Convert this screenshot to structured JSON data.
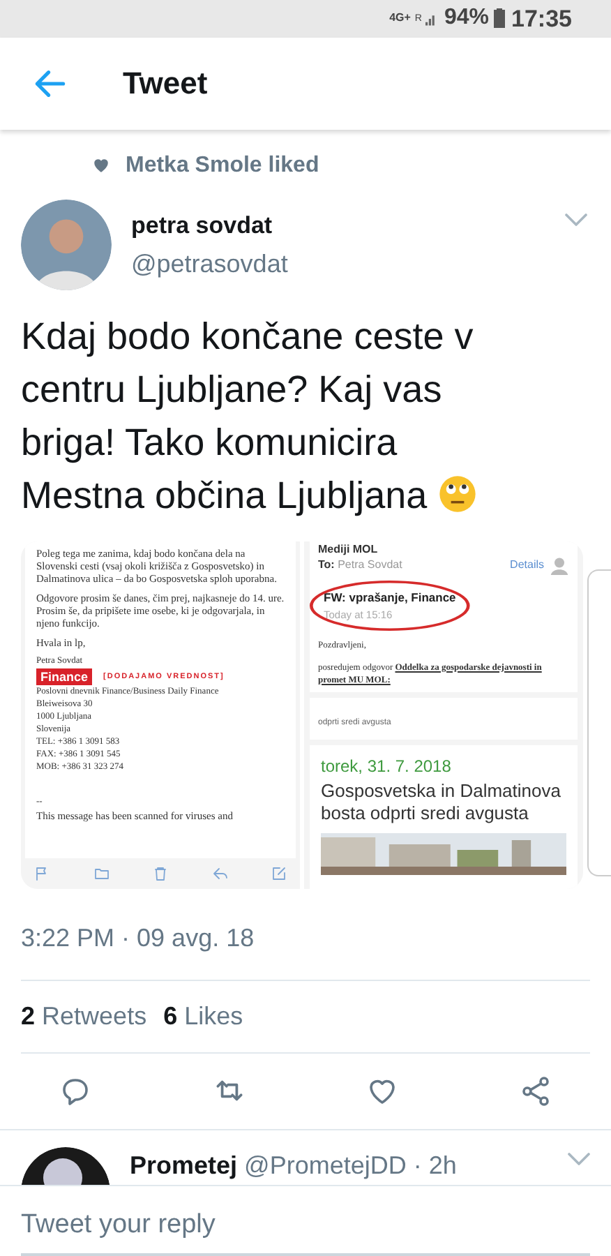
{
  "status_bar": {
    "network": "4G+",
    "roaming": "R",
    "battery": "94%",
    "time": "17:35"
  },
  "header": {
    "title": "Tweet"
  },
  "social_context": "Metka Smole liked",
  "tweet": {
    "name": "petra sovdat",
    "handle": "@petrasovdat",
    "text": "Kdaj bodo končane ceste v centru Ljubljane? Kaj vas briga! Tako komunicira Mestna občina Ljubljana",
    "email_left": {
      "paragraphs": [
        "Poleg tega me zanima, kdaj bodo končana dela na Slovenski cesti (vsaj okoli križišča z Gosposvetsko) in Dalmatinova ulica – da bo Gosposvetska sploh uporabna.",
        "Odgovore prosim še danes, čim prej, najkasneje do 14. ure. Prosim še, da pripišete ime osebe, ki je odgovarjala, in njeno funkcijo.",
        "Hvala in lp,"
      ],
      "signer": "Petra Sovdat",
      "logo": "Finance",
      "slogan": "[DODAJAMO VREDNOST]",
      "signature": [
        "Poslovni dnevnik Finance/Business Daily Finance",
        "Bleiweisova 30",
        "1000 Ljubljana",
        "Slovenija",
        "TEL: +386 1 3091 583",
        "FAX: +386 1 3091 545",
        "MOB: +386 31 323 274"
      ],
      "separator": "--",
      "footer": "This message has been scanned for viruses and"
    },
    "email_right": {
      "from": "Mediji MOL",
      "to_label": "To:",
      "to": "Petra Sovdat",
      "details": "Details",
      "subject": "FW: vprašanje, Finance",
      "date": "Today at 15:16",
      "greeting": "Pozdravljeni,",
      "body": "posredujem odgovor **Oddelka za gospodarske dejavnosti in promet MU MOL:**",
      "article_tag": "odprti sredi avgusta",
      "article_date": "torek, 31. 7. 2018",
      "article_title": "Gosposvetska in Dalmatinova bosta odprti sredi avgusta"
    },
    "timestamp": "3:22 PM · 09 avg. 18",
    "stats": [
      {
        "count": "2",
        "label": "Retweets"
      },
      {
        "count": "6",
        "label": "Likes"
      }
    ]
  },
  "reply_preview": {
    "name": "Prometej",
    "handle": "@PrometejDD",
    "time": "· 2h"
  },
  "reply_field": {
    "placeholder": "Tweet your reply"
  }
}
